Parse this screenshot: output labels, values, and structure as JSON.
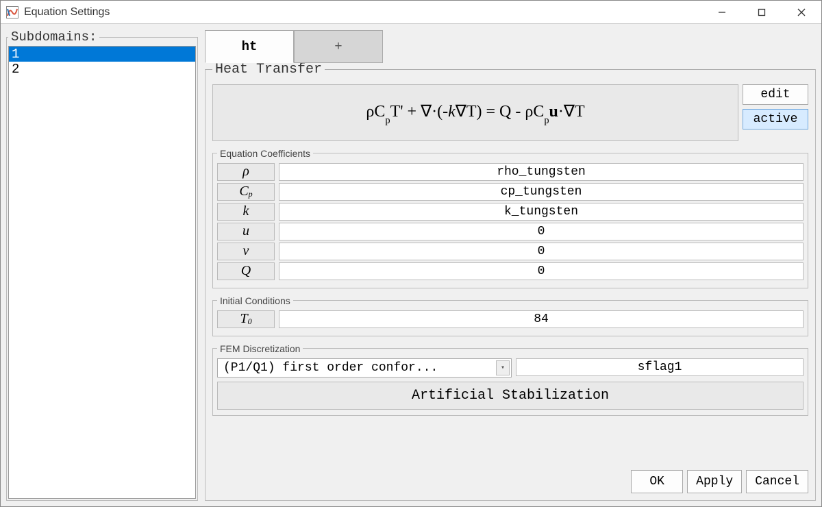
{
  "window": {
    "title": "Equation Settings"
  },
  "subdomains": {
    "legend": "Subdomains:",
    "items": [
      "1",
      "2"
    ],
    "selectedIndex": 0
  },
  "tabs": {
    "active": "ht",
    "plus": "+"
  },
  "heatTransfer": {
    "legend": "Heat Transfer",
    "buttons": {
      "edit": "edit",
      "active": "active"
    }
  },
  "equationCoeffs": {
    "legend": "Equation Coefficients",
    "rows": [
      {
        "label_html": "ρ",
        "value": "rho_tungsten"
      },
      {
        "label_html": "C<sub>p</sub>",
        "value": "cp_tungsten"
      },
      {
        "label_html": "k",
        "value": "k_tungsten"
      },
      {
        "label_html": "u",
        "value": "0"
      },
      {
        "label_html": "v",
        "value": "0"
      },
      {
        "label_html": "Q",
        "value": "0"
      }
    ]
  },
  "initialConditions": {
    "legend": "Initial Conditions",
    "rows": [
      {
        "label_html": "T<sub>0</sub>",
        "value": "84"
      }
    ]
  },
  "fem": {
    "legend": "FEM Discretization",
    "selectValue": "(P1/Q1) first order confor...",
    "sflag": "sflag1",
    "stabLabel": "Artificial Stabilization"
  },
  "dialog": {
    "ok": "OK",
    "apply": "Apply",
    "cancel": "Cancel"
  }
}
